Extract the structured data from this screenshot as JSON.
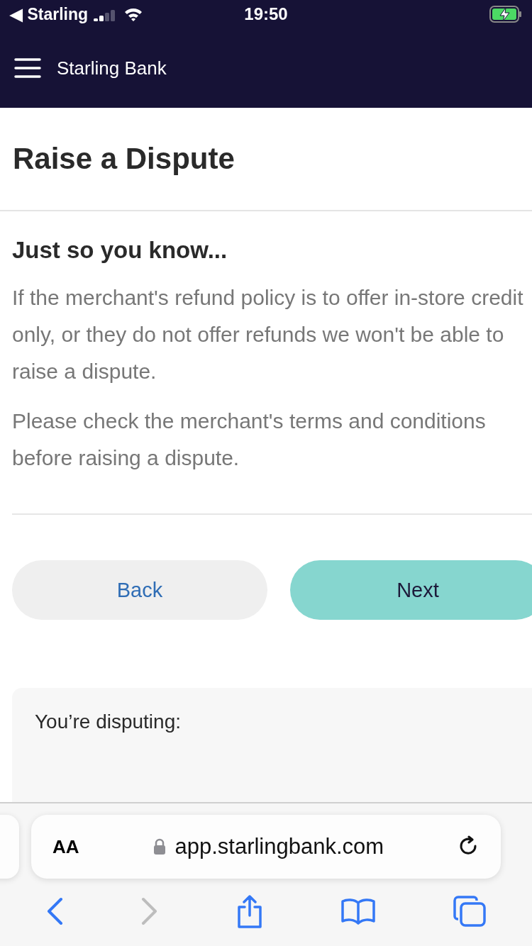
{
  "status_bar": {
    "back_app": "◀ Starling",
    "time": "19:50",
    "signal": {
      "level": 0.5
    },
    "charging": true
  },
  "header": {
    "title": "Starling Bank"
  },
  "page": {
    "title": "Raise a Dispute"
  },
  "notice": {
    "heading": "Just so you know...",
    "paragraphs": [
      "If the merchant's refund policy is to offer in-store credit only, or they do not offer refunds we won't be able to raise a dispute.",
      "Please check the merchant's terms and conditions before raising a dispute."
    ]
  },
  "buttons": [
    {
      "label": "Back",
      "kind": "secondary"
    },
    {
      "label": "Next",
      "kind": "primary"
    }
  ],
  "summary": {
    "heading": "You’re disputing:"
  },
  "browser": {
    "text_size": "AA",
    "url": "app.starlingbank.com",
    "back_enabled": true,
    "forward_enabled": false
  }
}
